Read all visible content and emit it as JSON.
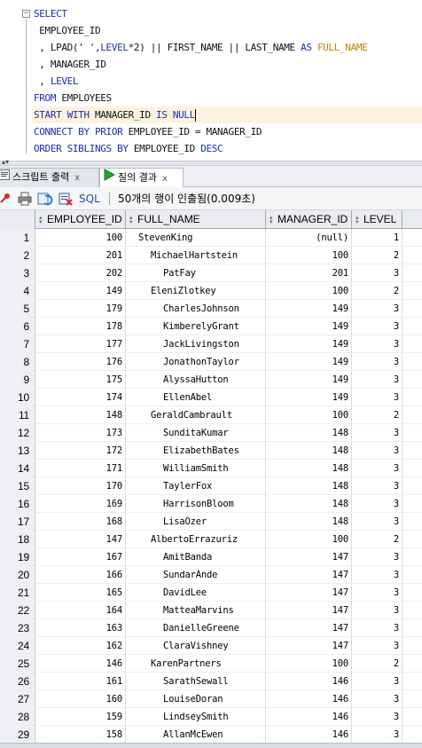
{
  "editor": {
    "lines": [
      {
        "parts": [
          {
            "t": "SELECT",
            "c": "kw"
          }
        ]
      },
      {
        "parts": [
          {
            "t": " EMPLOYEE_ID",
            "c": "id"
          }
        ]
      },
      {
        "parts": [
          {
            "t": " , LPAD(' ',",
            "c": "id"
          },
          {
            "t": "LEVEL",
            "c": "kw"
          },
          {
            "t": "*2) || FIRST_NAME || LAST_NAME ",
            "c": "id"
          },
          {
            "t": "AS ",
            "c": "kw"
          },
          {
            "t": "FULL_NAME",
            "c": "ac"
          }
        ]
      },
      {
        "parts": [
          {
            "t": " , MANAGER_ID",
            "c": "id"
          }
        ]
      },
      {
        "parts": [
          {
            "t": " , ",
            "c": "id"
          },
          {
            "t": "LEVEL",
            "c": "kw"
          }
        ]
      },
      {
        "parts": [
          {
            "t": "FROM ",
            "c": "kw"
          },
          {
            "t": "EMPLOYEES",
            "c": "id"
          }
        ]
      },
      {
        "parts": [
          {
            "t": "START WITH ",
            "c": "kw"
          },
          {
            "t": "MANAGER_ID ",
            "c": "id"
          },
          {
            "t": "IS NULL",
            "c": "kw"
          }
        ],
        "current": true
      },
      {
        "parts": [
          {
            "t": "CONNECT BY PRIOR ",
            "c": "kw"
          },
          {
            "t": "EMPLOYEE_ID = MANAGER_ID",
            "c": "id"
          }
        ]
      },
      {
        "parts": [
          {
            "t": "ORDER SIBLINGS BY ",
            "c": "kw"
          },
          {
            "t": "EMPLOYEE_ID ",
            "c": "id"
          },
          {
            "t": "DESC",
            "c": "kw"
          }
        ]
      }
    ]
  },
  "tabs": {
    "script_output": "스크립트 출력",
    "query_result": "질의 결과",
    "close": "x"
  },
  "toolbar": {
    "sql_label": "SQL",
    "status": "50개의 행이 인출됨(0.009초)"
  },
  "grid": {
    "columns": [
      "EMPLOYEE_ID",
      "FULL_NAME",
      "MANAGER_ID",
      "LEVEL"
    ],
    "rows": [
      [
        "1",
        "100",
        "StevenKing",
        "(null)",
        "1",
        1
      ],
      [
        "2",
        "201",
        "MichaelHartstein",
        "100",
        "2",
        2
      ],
      [
        "3",
        "202",
        "PatFay",
        "201",
        "3",
        3
      ],
      [
        "4",
        "149",
        "EleniZlotkey",
        "100",
        "2",
        2
      ],
      [
        "5",
        "179",
        "CharlesJohnson",
        "149",
        "3",
        3
      ],
      [
        "6",
        "178",
        "KimberelyGrant",
        "149",
        "3",
        3
      ],
      [
        "7",
        "177",
        "JackLivingston",
        "149",
        "3",
        3
      ],
      [
        "8",
        "176",
        "JonathonTaylor",
        "149",
        "3",
        3
      ],
      [
        "9",
        "175",
        "AlyssaHutton",
        "149",
        "3",
        3
      ],
      [
        "10",
        "174",
        "EllenAbel",
        "149",
        "3",
        3
      ],
      [
        "11",
        "148",
        "GeraldCambrault",
        "100",
        "2",
        2
      ],
      [
        "12",
        "173",
        "SunditaKumar",
        "148",
        "3",
        3
      ],
      [
        "13",
        "172",
        "ElizabethBates",
        "148",
        "3",
        3
      ],
      [
        "14",
        "171",
        "WilliamSmith",
        "148",
        "3",
        3
      ],
      [
        "15",
        "170",
        "TaylerFox",
        "148",
        "3",
        3
      ],
      [
        "16",
        "169",
        "HarrisonBloom",
        "148",
        "3",
        3
      ],
      [
        "17",
        "168",
        "LisaOzer",
        "148",
        "3",
        3
      ],
      [
        "18",
        "147",
        "AlbertoErrazuriz",
        "100",
        "2",
        2
      ],
      [
        "19",
        "167",
        "AmitBanda",
        "147",
        "3",
        3
      ],
      [
        "20",
        "166",
        "SundarAnde",
        "147",
        "3",
        3
      ],
      [
        "21",
        "165",
        "DavidLee",
        "147",
        "3",
        3
      ],
      [
        "22",
        "164",
        "MatteaMarvins",
        "147",
        "3",
        3
      ],
      [
        "23",
        "163",
        "DanielleGreene",
        "147",
        "3",
        3
      ],
      [
        "24",
        "162",
        "ClaraVishney",
        "147",
        "3",
        3
      ],
      [
        "25",
        "146",
        "KarenPartners",
        "100",
        "2",
        2
      ],
      [
        "26",
        "161",
        "SarathSewall",
        "146",
        "3",
        3
      ],
      [
        "27",
        "160",
        "LouiseDoran",
        "146",
        "3",
        3
      ],
      [
        "28",
        "159",
        "LindseySmith",
        "146",
        "3",
        3
      ],
      [
        "29",
        "158",
        "AllanMcEwen",
        "146",
        "3",
        3
      ]
    ]
  },
  "icons": [
    "collapse-icon",
    "script-output-icon",
    "run-query-icon",
    "pin-icon",
    "print-icon",
    "refresh-icon",
    "export-icon",
    "sort-icon"
  ],
  "colors": {
    "keyword": "#1b2ea8",
    "alias": "#b48a00",
    "current_line": "#fbf3dd",
    "run_green": "#1fa82c"
  }
}
